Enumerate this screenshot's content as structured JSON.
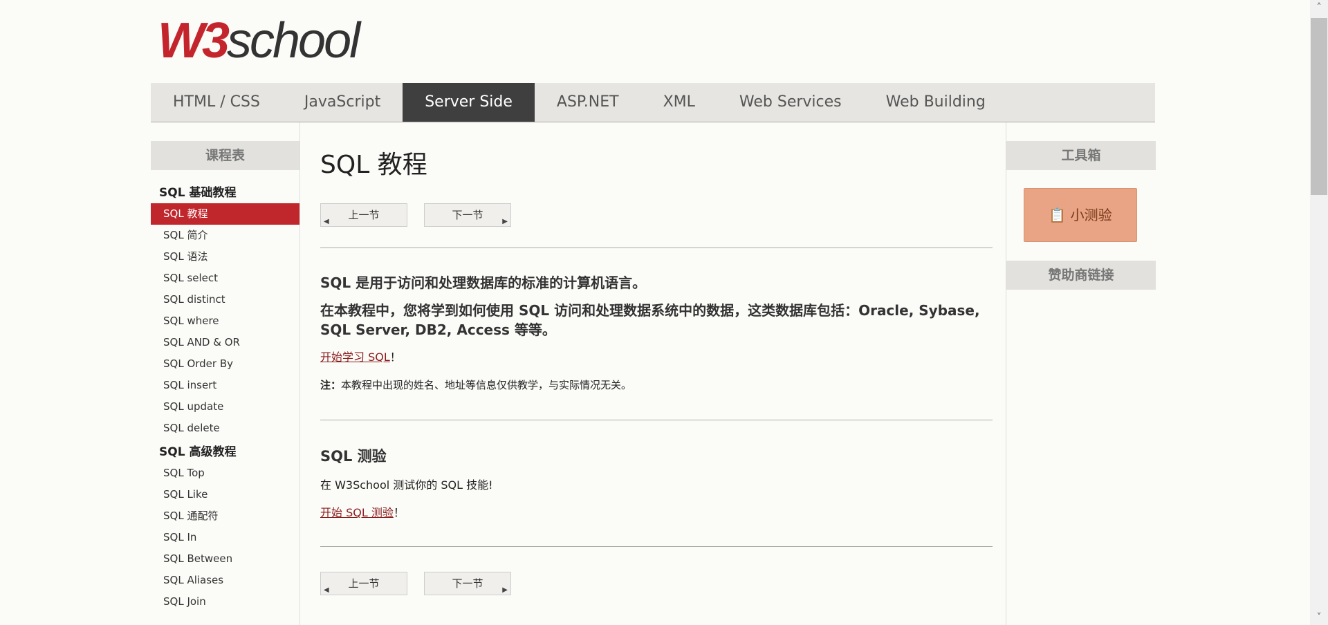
{
  "logo": {
    "w3": "W3",
    "school": "school"
  },
  "nav": {
    "tabs": [
      "HTML / CSS",
      "JavaScript",
      "Server Side",
      "ASP.NET",
      "XML",
      "Web Services",
      "Web Building"
    ],
    "active": 2
  },
  "sidebar": {
    "title": "课程表",
    "section1": "SQL 基础教程",
    "items1": [
      "SQL 教程",
      "SQL 简介",
      "SQL 语法",
      "SQL select",
      "SQL distinct",
      "SQL where",
      "SQL AND & OR",
      "SQL Order By",
      "SQL insert",
      "SQL update",
      "SQL delete"
    ],
    "section2": "SQL 高级教程",
    "items2": [
      "SQL Top",
      "SQL Like",
      "SQL 通配符",
      "SQL In",
      "SQL Between",
      "SQL Aliases",
      "SQL Join"
    ]
  },
  "main": {
    "title": "SQL 教程",
    "prev": "上一节",
    "next": "下一节",
    "lead1": "SQL 是用于访问和处理数据库的标准的计算机语言。",
    "lead2": "在本教程中，您将学到如何使用 SQL 访问和处理数据系统中的数据，这类数据库包括：Oracle, Sybase, SQL Server, DB2, Access 等等。",
    "start_link": "开始学习 SQL",
    "excl": "！",
    "note_label": "注：",
    "note_text": "本教程中出现的姓名、地址等信息仅供教学，与实际情况无关。",
    "quiz_title": "SQL 测验",
    "quiz_text": "在 W3School 测试你的 SQL 技能!",
    "quiz_link": "开始 SQL 测验"
  },
  "right": {
    "toolbox": "工具箱",
    "quiz_button": "小测验",
    "sponsor": "赞助商链接"
  }
}
